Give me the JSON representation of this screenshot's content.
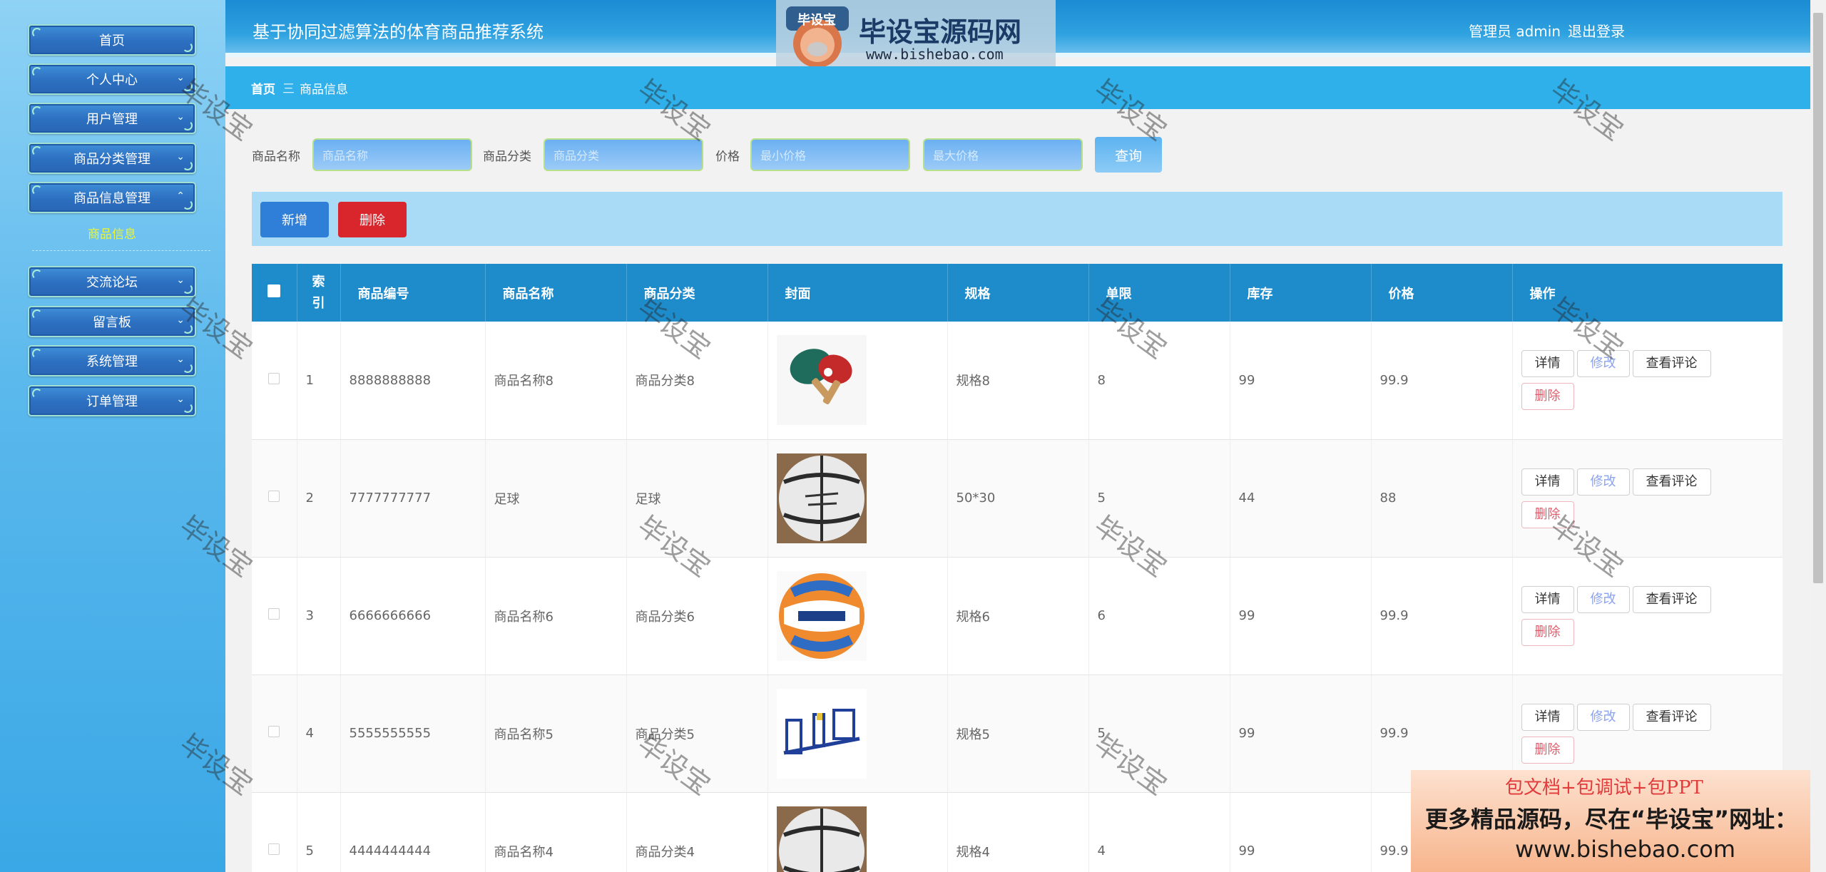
{
  "sidebar": {
    "items": [
      {
        "label": "首页"
      },
      {
        "label": "个人中心"
      },
      {
        "label": "用户管理"
      },
      {
        "label": "商品分类管理"
      },
      {
        "label": "商品信息管理"
      },
      {
        "label": "交流论坛"
      },
      {
        "label": "留言板"
      },
      {
        "label": "系统管理"
      },
      {
        "label": "订单管理"
      }
    ],
    "active_subitem": "商品信息"
  },
  "header": {
    "title": "基于协同过滤算法的体育商品推荐系统",
    "admin": "管理员 admin",
    "logout": "退出登录"
  },
  "logo": {
    "badge": "毕设宝",
    "name": "毕设宝源码网",
    "url": "www.bishebao.com"
  },
  "breadcrumb": {
    "home": "首页",
    "separator": "三",
    "current": "商品信息"
  },
  "search": {
    "name_label": "商品名称",
    "name_placeholder": "商品名称",
    "category_label": "商品分类",
    "category_placeholder": "商品分类",
    "price_label": "价格",
    "price_min_placeholder": "最小价格",
    "price_max_placeholder": "最大价格",
    "button": "查询"
  },
  "toolbar": {
    "add": "新增",
    "delete": "删除"
  },
  "table": {
    "columns": [
      "索引",
      "商品编号",
      "商品名称",
      "商品分类",
      "封面",
      "规格",
      "单限",
      "库存",
      "价格",
      "操作"
    ],
    "index_header_line1": "索",
    "index_header_line2": "引",
    "rows": [
      {
        "index": "1",
        "code": "8888888888",
        "name": "商品名称8",
        "category": "商品分类8",
        "cover": "table-tennis-paddles",
        "spec": "规格8",
        "limit": "8",
        "stock": "99",
        "price": "99.9"
      },
      {
        "index": "2",
        "code": "7777777777",
        "name": "足球",
        "category": "足球",
        "cover": "basketball",
        "spec": "50*30",
        "limit": "5",
        "stock": "44",
        "price": "88"
      },
      {
        "index": "3",
        "code": "6666666666",
        "name": "商品名称6",
        "category": "商品分类6",
        "cover": "volleyball",
        "spec": "规格6",
        "limit": "6",
        "stock": "99",
        "price": "99.9"
      },
      {
        "index": "4",
        "code": "5555555555",
        "name": "商品名称5",
        "category": "商品分类5",
        "cover": "fitness-equipment",
        "spec": "规格5",
        "limit": "5",
        "stock": "99",
        "price": "99.9"
      },
      {
        "index": "5",
        "code": "4444444444",
        "name": "商品名称4",
        "category": "商品分类4",
        "cover": "basketball",
        "spec": "规格4",
        "limit": "4",
        "stock": "99",
        "price": "99.9"
      }
    ],
    "actions": {
      "detail": "详情",
      "edit": "修改",
      "comments": "查看评论",
      "delete": "删除"
    }
  },
  "watermark": "毕设宝",
  "promo": {
    "line1": "包文档+包调试+包PPT",
    "line2": "更多精品源码，尽在“毕设宝”网址：",
    "line3": "www.bishebao.com"
  },
  "colors": {
    "header_blue": "#1e8bcb",
    "delete_red": "#d9262c",
    "add_blue": "#2f7ed8",
    "active_submenu": "#e8f53a"
  }
}
